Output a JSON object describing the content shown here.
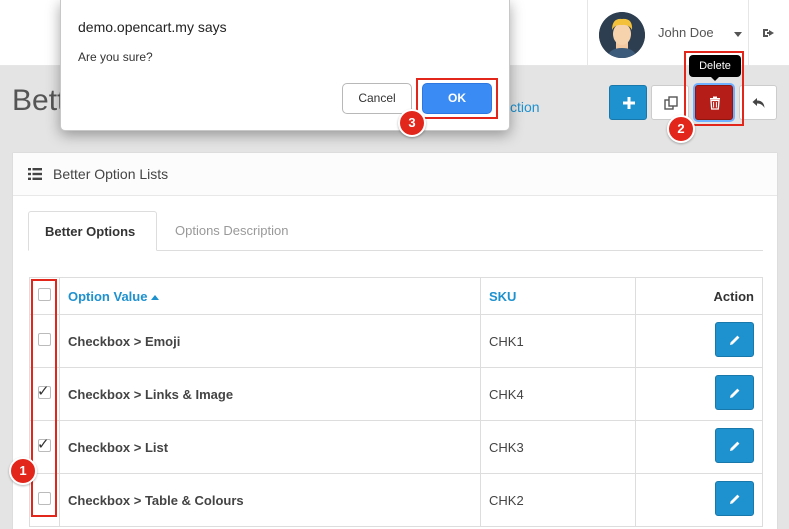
{
  "header": {
    "user_name": "John Doe"
  },
  "page": {
    "title": "Bette",
    "breadcrumb_fragment": "ction",
    "tooltip": "Delete"
  },
  "panel": {
    "title": "Better Option Lists",
    "tabs": [
      {
        "label": "Better Options",
        "active": true
      },
      {
        "label": "Options Description",
        "active": false
      }
    ]
  },
  "table": {
    "columns": {
      "option_value": "Option Value",
      "sku": "SKU",
      "action": "Action"
    },
    "rows": [
      {
        "option": "Checkbox > Emoji",
        "sku": "CHK1",
        "checked": false
      },
      {
        "option": "Checkbox > Links & Image",
        "sku": "CHK4",
        "checked": true
      },
      {
        "option": "Checkbox > List",
        "sku": "CHK3",
        "checked": true
      },
      {
        "option": "Checkbox > Table & Colours",
        "sku": "CHK2",
        "checked": false
      }
    ]
  },
  "dialog": {
    "title": "demo.opencart.my says",
    "message": "Are you sure?",
    "cancel_label": "Cancel",
    "ok_label": "OK"
  },
  "annotations": {
    "step1": "1",
    "step2": "2",
    "step3": "3"
  },
  "colors": {
    "primary": "#1e91cf",
    "danger": "#b51e18",
    "annotation": "#e3261b",
    "dialog_ok": "#3b8bf5"
  }
}
